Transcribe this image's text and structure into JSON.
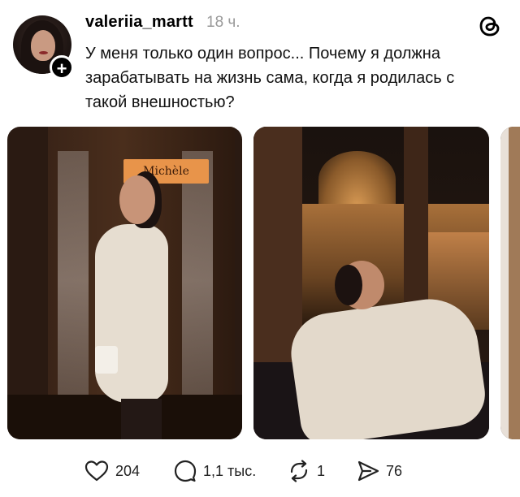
{
  "post": {
    "username": "valeriia_martt",
    "time": "18 ч.",
    "text": "У меня только один вопрос... Почему я должна зарабатывать на жизнь сама, когда я родилась с такой внешностью?"
  },
  "photo_1": {
    "sign_text": "Michèle"
  },
  "actions": {
    "likes": "204",
    "replies": "1,1 тыс.",
    "reposts": "1",
    "shares": "76"
  },
  "icons": {
    "avatar": "avatar",
    "follow": "plus-icon",
    "app": "threads-logo-icon",
    "like": "heart-icon",
    "reply": "comment-bubble-icon",
    "repost": "repost-icon",
    "share": "send-icon"
  },
  "colors": {
    "text": "#000000",
    "secondary": "#999999",
    "background": "#ffffff"
  }
}
